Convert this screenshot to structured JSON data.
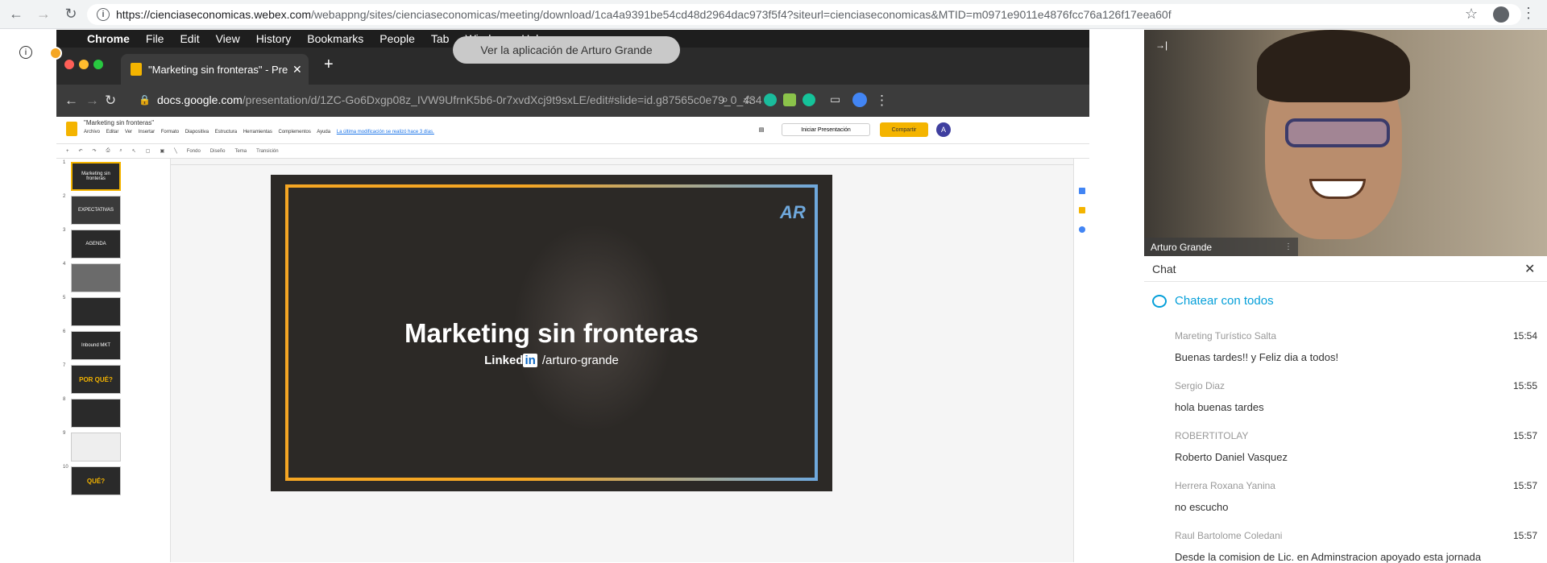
{
  "browser": {
    "url_host": "https://cienciaseconomicas.webex.com",
    "url_rest": "/webappng/sites/cienciaseconomicas/meeting/download/1ca4a9391be54cd48d2964dac973f5f4?siteurl=cienciaseconomicas&MTID=m0971e9011e4876fcc76a126f17eea60f"
  },
  "shared": {
    "mac_menu": [
      "Chrome",
      "File",
      "Edit",
      "View",
      "History",
      "Bookmarks",
      "People",
      "Tab",
      "Window",
      "Help"
    ],
    "tooltip": "Ver la aplicación de Arturo Grande",
    "tab_title": "\"Marketing sin fronteras\" - Pre",
    "url_host": "docs.google.com",
    "url_rest": "/presentation/d/1ZC-Go6Dxgp08z_IVW9UfrnK5b6-0r7xvdXcj9t9sxLE/edit#slide=id.g87565c0e79_0_434",
    "doc_title": "\"Marketing sin fronteras\"",
    "menu": [
      "Archivo",
      "Editar",
      "Ver",
      "Insertar",
      "Formato",
      "Diapositiva",
      "Estructura",
      "Herramientas",
      "Complementos",
      "Ayuda"
    ],
    "last_edit": "La última modificación se realizó hace 3 días.",
    "present_label": "Iniciar Presentación",
    "share_label": "Compartir",
    "avatar_letter": "A",
    "toolbar": [
      "Fondo",
      "Diseño",
      "Tema",
      "Transición"
    ],
    "thumbs": [
      {
        "n": "1",
        "t": "Marketing sin fronteras"
      },
      {
        "n": "2",
        "t": "EXPECTATIVAS"
      },
      {
        "n": "3",
        "t": "AGENDA"
      },
      {
        "n": "4",
        "t": ""
      },
      {
        "n": "5",
        "t": ""
      },
      {
        "n": "6",
        "t": "Inbound MKT"
      },
      {
        "n": "7",
        "t": "POR QUÉ?"
      },
      {
        "n": "8",
        "t": ""
      },
      {
        "n": "9",
        "t": ""
      },
      {
        "n": "10",
        "t": "QUÉ?"
      }
    ],
    "slide_title": "Marketing sin fronteras",
    "slide_linkedin": "Linked",
    "slide_in": "in",
    "slide_handle": "/arturo-grande",
    "slide_logo": "AR"
  },
  "video": {
    "name": "Arturo Grande"
  },
  "chat": {
    "title": "Chat",
    "to": "Chatear con todos",
    "messages": [
      {
        "from": "Mareting Turístico Salta",
        "time": "15:54",
        "text": "Buenas tardes!! y Feliz dia a todos!"
      },
      {
        "from": "Sergio Diaz",
        "time": "15:55",
        "text": "hola buenas tardes"
      },
      {
        "from": "ROBERTITOLAY",
        "time": "15:57",
        "text": "Roberto Daniel Vasquez"
      },
      {
        "from": "Herrera Roxana Yanina",
        "time": "15:57",
        "text": "no escucho"
      },
      {
        "from": "Raul Bartolome Coledani",
        "time": "15:57",
        "text": "Desde la comision de Lic. en Adminstracion apoyado esta jornada"
      }
    ]
  }
}
